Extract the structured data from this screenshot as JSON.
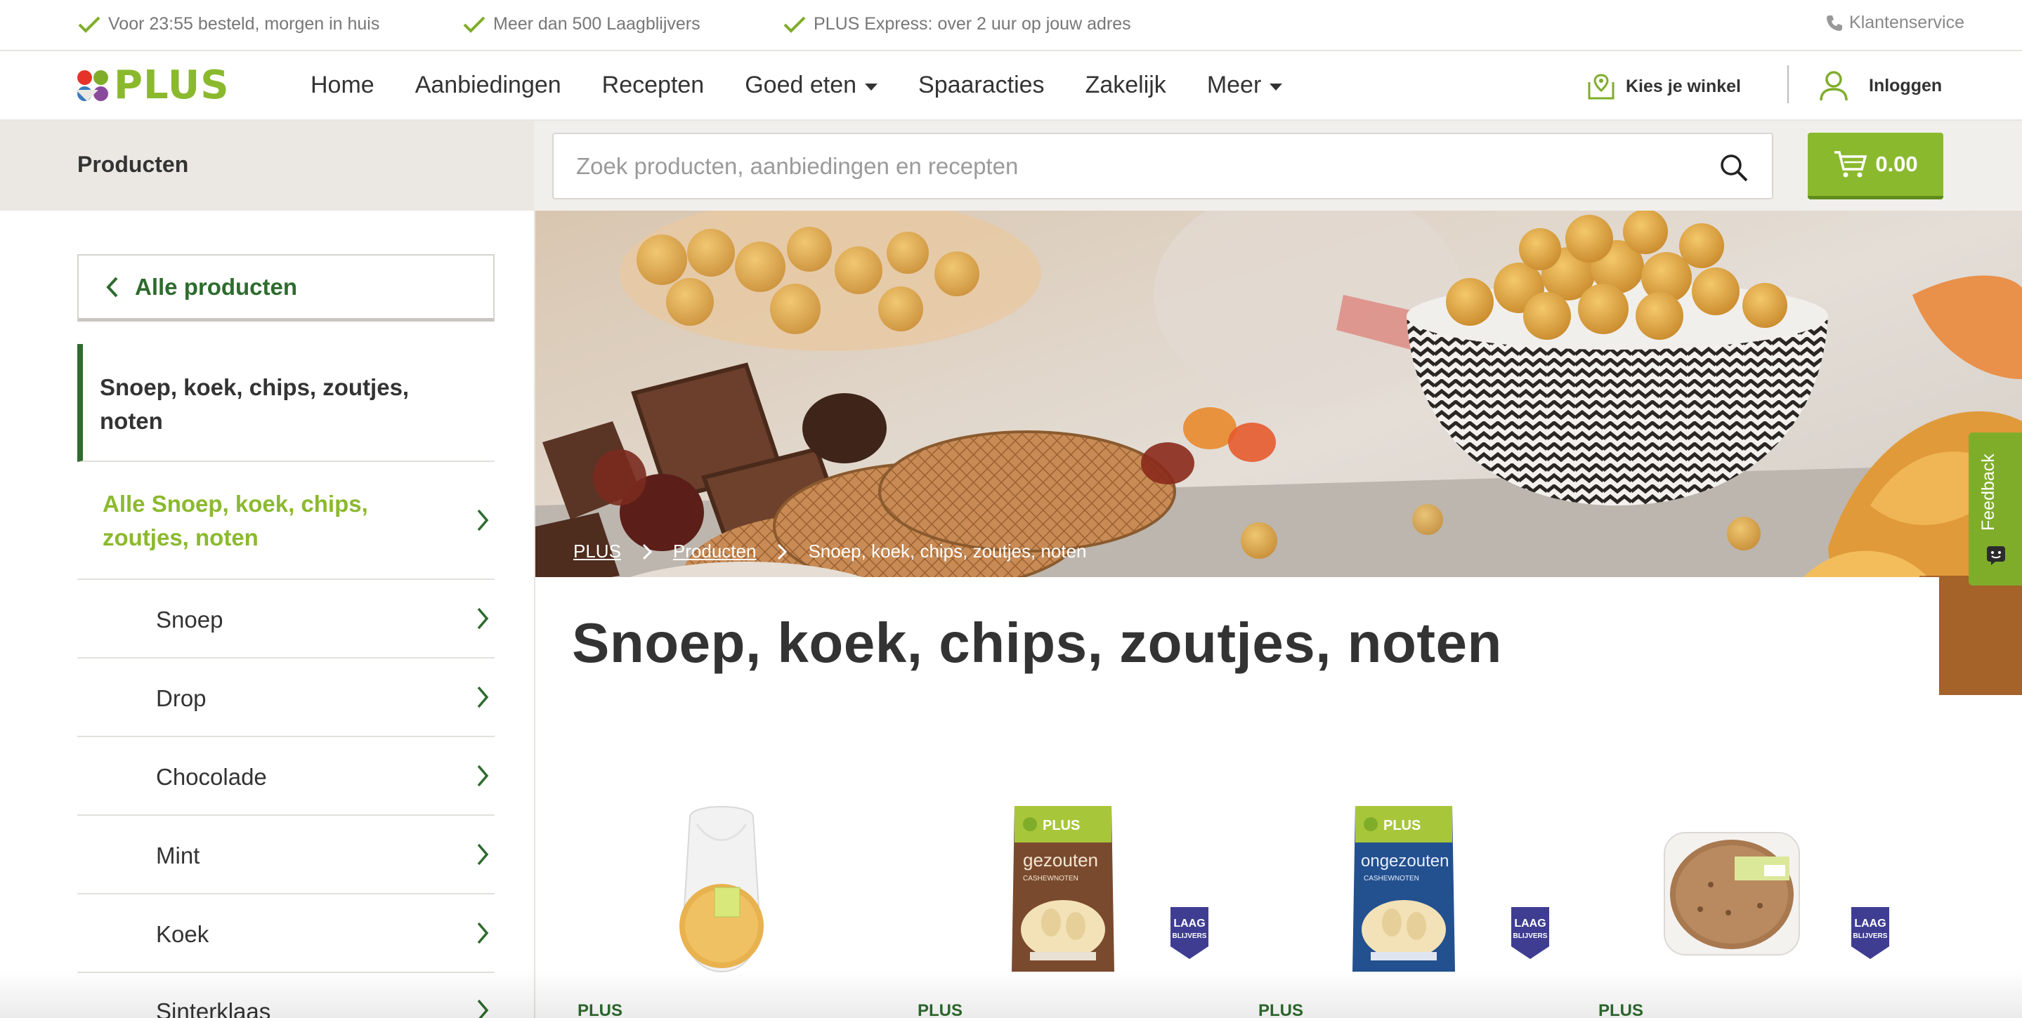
{
  "usps": [
    {
      "text": "Voor 23:55 besteld, morgen in huis",
      "icon": "check-icon"
    },
    {
      "text": "Meer dan 500 Laagblijvers",
      "icon": "check-icon"
    },
    {
      "text": "PLUS Express: over 2 uur op jouw adres",
      "icon": "check-icon"
    }
  ],
  "customer_service": "Klantenservice",
  "brand": {
    "name": "PLUS",
    "color": "#8bb92e",
    "dark_green": "#2e6b2e"
  },
  "nav": {
    "items": [
      "Home",
      "Aanbiedingen",
      "Recepten",
      "Goed eten",
      "Spaaracties",
      "Zakelijk",
      "Meer"
    ],
    "store_label": "Kies je winkel",
    "login_label": "Inloggen"
  },
  "subbar": {
    "tab_label": "Producten",
    "search_placeholder": "Zoek producten, aanbiedingen en recepten",
    "cart_total": "0.00"
  },
  "sidebar": {
    "back_label": "Alle producten",
    "active_category": "Snoep, koek, chips, zoutjes, noten",
    "all_label": "Alle Snoep, koek, chips, zoutjes, noten",
    "subcategories": [
      "Snoep",
      "Drop",
      "Chocolade",
      "Mint",
      "Koek",
      "Sinterklaas"
    ]
  },
  "breadcrumb": [
    "PLUS",
    "Producten",
    "Snoep, koek, chips, zoutjes, noten"
  ],
  "page_title": "Snoep, koek, chips, zoutjes, noten",
  "feedback_label": "Feedback",
  "products": [
    {
      "brand": "PLUS",
      "laagblijver": false
    },
    {
      "brand": "PLUS",
      "pack_text": "gezouten",
      "pack_sub": "CASHEWNOTEN",
      "laagblijver": true
    },
    {
      "brand": "PLUS",
      "pack_text": "ongezouten",
      "pack_sub": "CASHEWNOTEN",
      "laagblijver": true
    },
    {
      "brand": "PLUS",
      "laagblijver": true
    }
  ],
  "laag_badge": [
    "LAAG",
    "BLIJVERS"
  ]
}
